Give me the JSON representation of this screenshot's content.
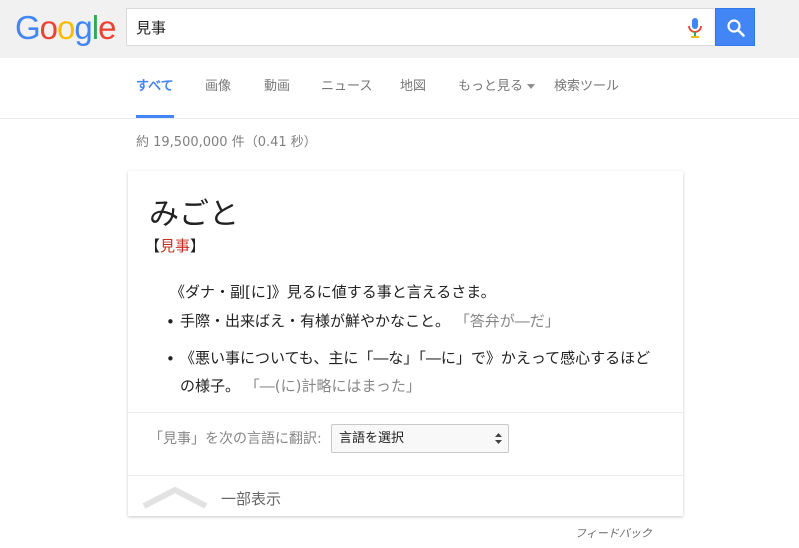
{
  "header": {
    "logo_letters": [
      "G",
      "o",
      "o",
      "g",
      "l",
      "e"
    ],
    "search_value": "見事",
    "colors": {
      "brand_blue": "#4285f4",
      "red": "#ea4335",
      "yellow": "#fbbc05",
      "green": "#34a853"
    }
  },
  "tabs": [
    {
      "label": "すべて",
      "active": true
    },
    {
      "label": "画像"
    },
    {
      "label": "動画"
    },
    {
      "label": "ニュース"
    },
    {
      "label": "地図"
    },
    {
      "label": "もっと見る"
    },
    {
      "label": "検索ツール"
    }
  ],
  "result_stats": "約 19,500,000 件（0.41 秒）",
  "card": {
    "reading": "みごと",
    "kanji_open": "【",
    "kanji": "見事",
    "kanji_close": "】",
    "definition": "《ダナ・副[に]》見るに値する事と言えるさま。",
    "bullets": [
      {
        "text": "手際・出来ばえ・有様が鮮やかなこと。",
        "example": "「答弁が―だ」"
      },
      {
        "text": "《悪い事についても、主に「―な」「―に」で》かえって感心するほどの様子。",
        "example": "「―(に)計略にはまった」"
      }
    ],
    "translate_label": "「見事」を次の言語に翻訳:",
    "translate_select": "言語を選択",
    "collapse_label": "一部表示"
  },
  "feedback": "フィードバック"
}
